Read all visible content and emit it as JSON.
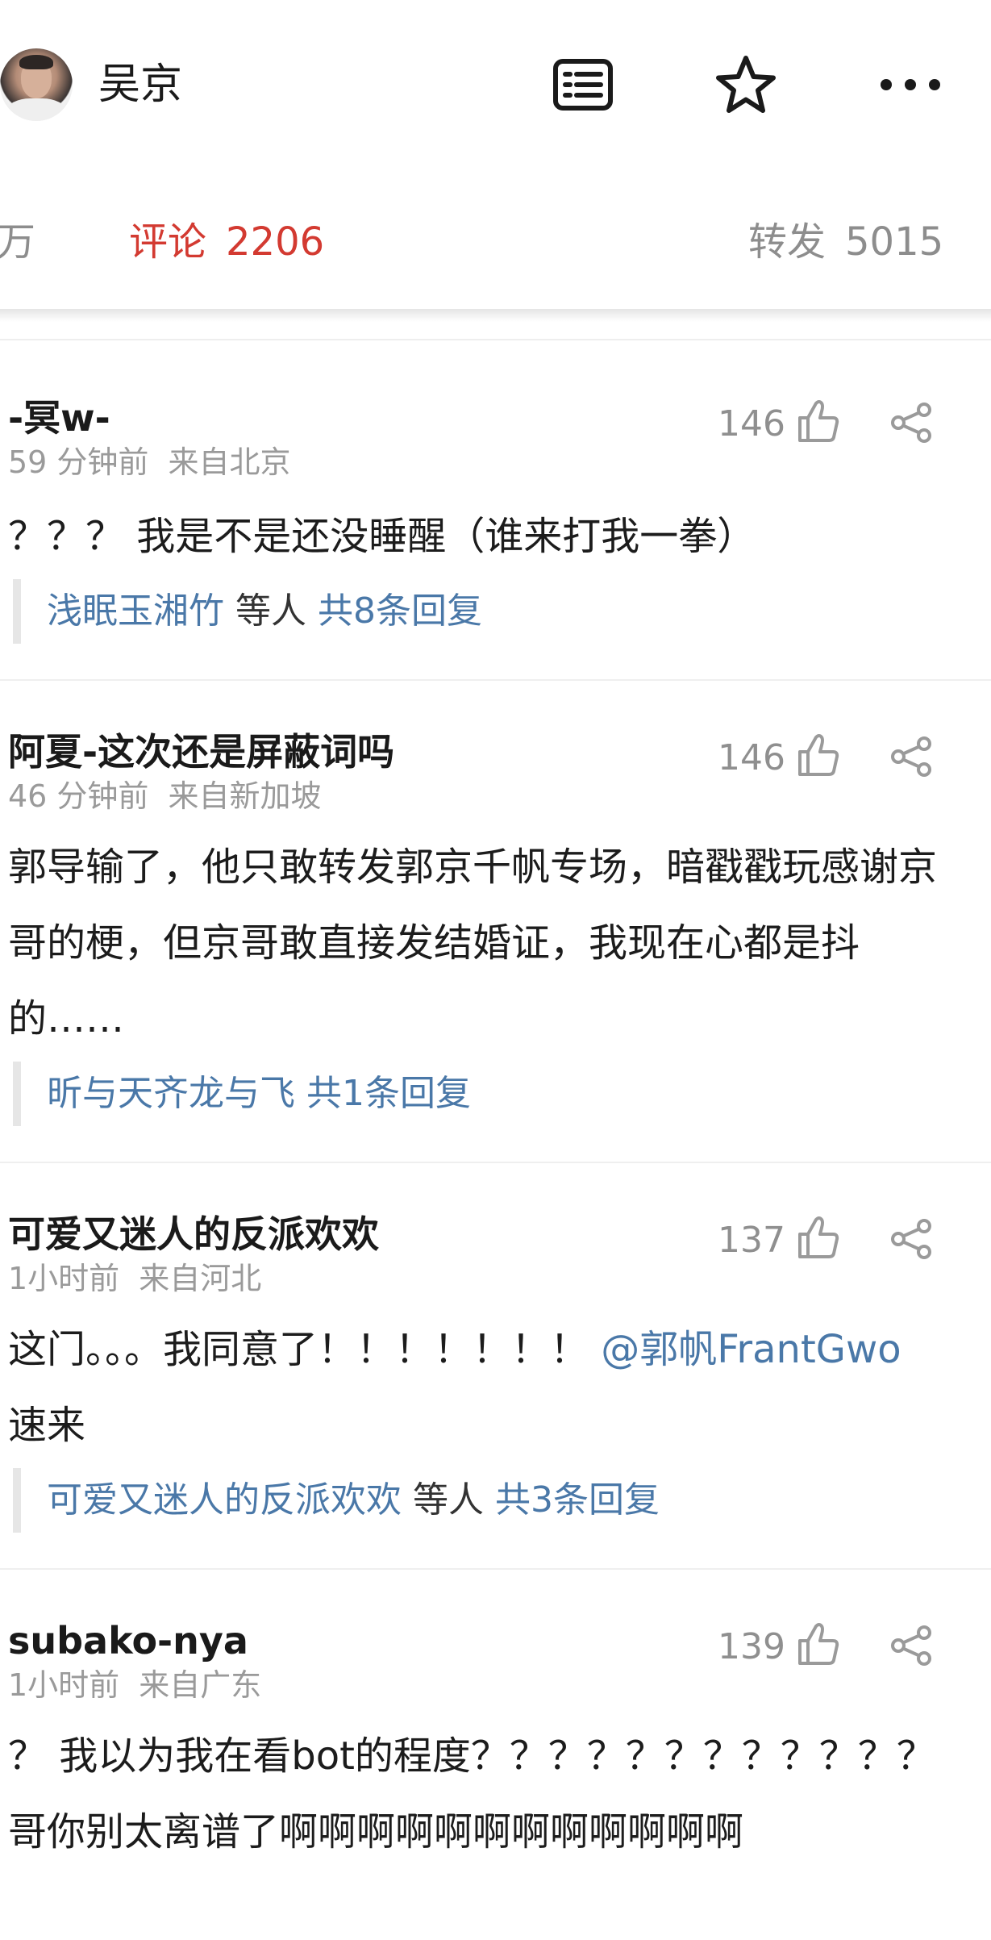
{
  "header": {
    "user_name": "吴京",
    "icons": [
      "avatar",
      "article-icon",
      "star-icon",
      "more-icon"
    ]
  },
  "tabs": {
    "likes_label": "万",
    "comments_label": "评论",
    "comments_count": "2206",
    "reposts_label": "转发",
    "reposts_count": "5015"
  },
  "colors": {
    "active_tab": "#d33a31",
    "link": "#4a78a8",
    "meta": "#9a9a9a"
  },
  "comments": [
    {
      "author": "-冥w-",
      "time": "59 分钟前",
      "source": "来自北京",
      "likes": "146",
      "text": "？？？ 我是不是还没睡醒（谁来打我一拳）",
      "reply_names": "浅眠玉湘竹",
      "reply_suffix": " 等人 ",
      "reply_count": "共8条回复"
    },
    {
      "author": "阿夏-这次还是屏蔽词吗",
      "time": "46 分钟前",
      "source": "来自新加坡",
      "likes": "146",
      "text": "郭导输了，他只敢转发郭京千帆专场，暗戳戳玩感谢京哥的梗，但京哥敢直接发结婚证，我现在心都是抖的……",
      "reply_names": "昕与天齐龙与飞",
      "reply_suffix": " ",
      "reply_count": "共1条回复"
    },
    {
      "author": "可爱又迷人的反派欢欢",
      "time": "1小时前",
      "source": "来自河北",
      "likes": "137",
      "text": "这门。。。我同意了！！！！！！！ ",
      "mention": "@郭帆FrantGwo",
      "text_after": " 速来",
      "reply_names": "可爱又迷人的反派欢欢",
      "reply_suffix": " 等人 ",
      "reply_count": "共3条回复"
    },
    {
      "author": "subako-nya",
      "time": "1小时前",
      "source": "来自广东",
      "likes": "139",
      "text": "？ 我以为我在看bot的程度？？？？？？？？？？？？哥你别太离谱了啊啊啊啊啊啊啊啊啊啊啊啊"
    }
  ]
}
